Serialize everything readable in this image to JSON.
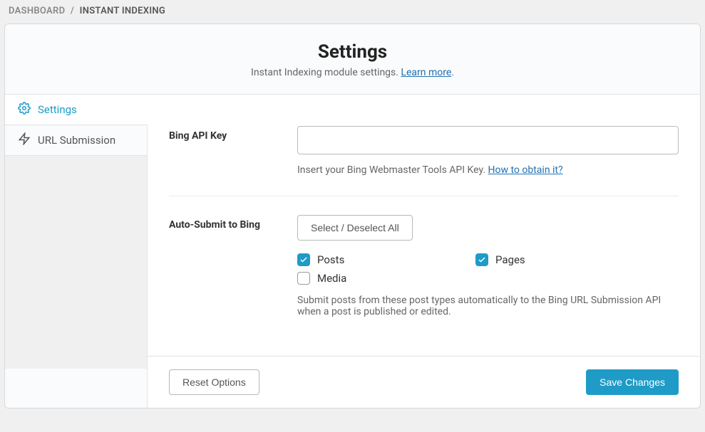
{
  "breadcrumb": {
    "root": "DASHBOARD",
    "current": "INSTANT INDEXING"
  },
  "header": {
    "title": "Settings",
    "subtitle": "Instant Indexing module settings. ",
    "learn_more": "Learn more"
  },
  "tabs": [
    {
      "label": "Settings"
    },
    {
      "label": "URL Submission"
    }
  ],
  "fields": {
    "api_key": {
      "label": "Bing API Key",
      "value": "",
      "help_prefix": "Insert your Bing Webmaster Tools API Key. ",
      "help_link": "How to obtain it?"
    },
    "auto_submit": {
      "label": "Auto-Submit to Bing",
      "toggle_all": "Select / Deselect All",
      "options": {
        "posts": {
          "label": "Posts",
          "checked": true
        },
        "pages": {
          "label": "Pages",
          "checked": true
        },
        "media": {
          "label": "Media",
          "checked": false
        }
      },
      "help": "Submit posts from these post types automatically to the Bing URL Submission API when a post is published or edited."
    }
  },
  "footer": {
    "reset": "Reset Options",
    "save": "Save Changes"
  }
}
